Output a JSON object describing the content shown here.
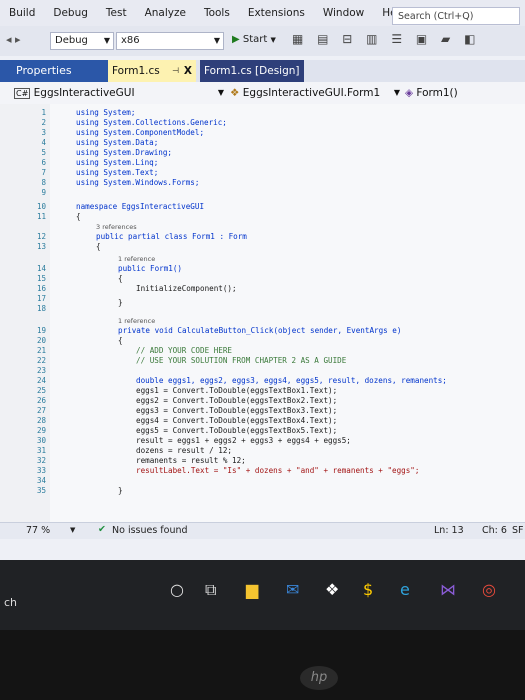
{
  "menu": [
    "Build",
    "Debug",
    "Test",
    "Analyze",
    "Tools",
    "Extensions",
    "Window",
    "Help"
  ],
  "search_placeholder": "Search (Ctrl+Q)",
  "toolbar": {
    "config": "Debug",
    "platform": "x86",
    "start": "Start"
  },
  "panel": {
    "properties": "Properties"
  },
  "tabs": [
    {
      "label": "Form1.cs",
      "close": "X"
    },
    {
      "label": "Form1.cs [Design]"
    }
  ],
  "nav": {
    "project": "EggsInteractiveGUI",
    "class": "EggsInteractiveGUI.Form1",
    "member": "Form1()"
  },
  "editor": {
    "line_numbers": [
      "1",
      "2",
      "3",
      "4",
      "5",
      "6",
      "7",
      "8",
      "9",
      "10",
      "11",
      "12",
      "13",
      "14",
      "15",
      "16",
      "17",
      "18",
      "19",
      "20",
      "21",
      "22",
      "23",
      "24",
      "25",
      "26",
      "27",
      "28",
      "29",
      "30",
      "31",
      "32",
      "33",
      "34",
      "35"
    ],
    "refs": {
      "class": "3 references",
      "ctor": "1 reference",
      "method": "1 reference"
    },
    "usings": [
      "using System;",
      "using System.Collections.Generic;",
      "using System.ComponentModel;",
      "using System.Data;",
      "using System.Drawing;",
      "using System.Linq;",
      "using System.Text;",
      "using System.Windows.Forms;"
    ],
    "namespace_line": "namespace EggsInteractiveGUI",
    "open_brace": "{",
    "class_line": "public partial class Form1 : Form",
    "ctor_line": "public Form1()",
    "init_line": "InitializeComponent();",
    "close_brace": "}",
    "method_line": "private void CalculateButton_Click(object sender, EventArgs e)",
    "comment1": "// ADD YOUR CODE HERE",
    "comment2": "// USE YOUR SOLUTION FROM CHAPTER 2 AS A GUIDE",
    "body": [
      "double eggs1, eggs2, eggs3, eggs4, eggs5, result, dozens, remanents;",
      "eggs1 = Convert.ToDouble(eggsTextBox1.Text);",
      "eggs2 = Convert.ToDouble(eggsTextBox2.Text);",
      "eggs3 = Convert.ToDouble(eggsTextBox3.Text);",
      "eggs4 = Convert.ToDouble(eggsTextBox4.Text);",
      "eggs5 = Convert.ToDouble(eggsTextBox5.Text);",
      "result = eggs1 + eggs2 + eggs3 + eggs4 + eggs5;",
      "dozens = result / 12;",
      "remanents = result % 12;",
      "resultLabel.Text = \"Is\" + dozens + \"and\" + remanents + \"eggs\";"
    ]
  },
  "status": {
    "zoom": "77 %",
    "issues": "No issues found",
    "line": "Ln: 13",
    "col": "Ch: 6",
    "extra": "SF"
  },
  "taskbar": {
    "search_text": "ch"
  },
  "bezel_logo": "hp",
  "colors": {
    "accent": "#2b57a8",
    "active_tab": "#fdf2b1",
    "keyword": "#0033cc",
    "comment": "#3b7a3b"
  }
}
